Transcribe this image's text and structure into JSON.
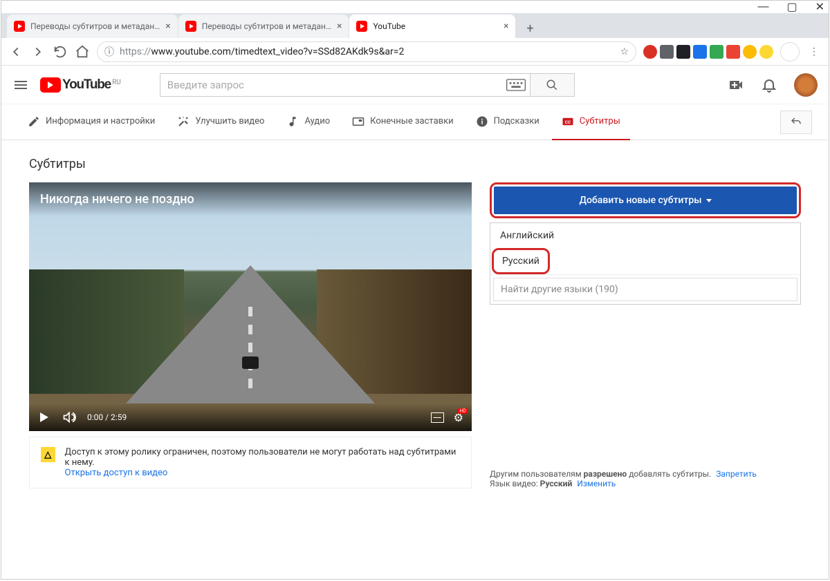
{
  "browser": {
    "tabs": [
      {
        "title": "Переводы субтитров и метадан…",
        "active": false,
        "favicon": "youtube"
      },
      {
        "title": "Переводы субтитров и метадан…",
        "active": false,
        "favicon": "youtube"
      },
      {
        "title": "YouTube",
        "active": true,
        "favicon": "youtube"
      }
    ],
    "url_prefix": "https://",
    "url_rest": "www.youtube.com/timedtext_video?v=SSd82AKdk9s&ar=2"
  },
  "yt_header": {
    "logo_text": "YouTube",
    "logo_region": "RU",
    "search_placeholder": "Введите запрос"
  },
  "yt_tabs": [
    {
      "icon": "pencil",
      "label": "Информация и настройки"
    },
    {
      "icon": "wand",
      "label": "Улучшить видео"
    },
    {
      "icon": "note",
      "label": "Аудио"
    },
    {
      "icon": "endcard",
      "label": "Конечные заставки"
    },
    {
      "icon": "info",
      "label": "Подсказки"
    },
    {
      "icon": "cc",
      "label": "Субтитры",
      "active": true
    }
  ],
  "section_title": "Субтитры",
  "video": {
    "title": "Никогда ничего не поздно",
    "time_current": "0:00",
    "time_total": "2:59",
    "hd_label": "HD"
  },
  "side": {
    "add_button": "Добавить новые субтитры",
    "lang_english": "Английский",
    "lang_russian": "Русский",
    "search_placeholder": "Найти другие языки (190)",
    "footer_line1_a": "Другим пользователям",
    "footer_line1_b": "разрешено",
    "footer_line1_c": "добавлять субтитры.",
    "forbid_link": "Запретить",
    "footer_line2_a": "Язык видео:",
    "footer_line2_b": "Русский",
    "change_link": "Изменить"
  },
  "warning": {
    "text": "Доступ к этому ролику ограничен, поэтому пользователи не могут работать над субтитрами к нему.",
    "link": "Открыть доступ к видео"
  }
}
